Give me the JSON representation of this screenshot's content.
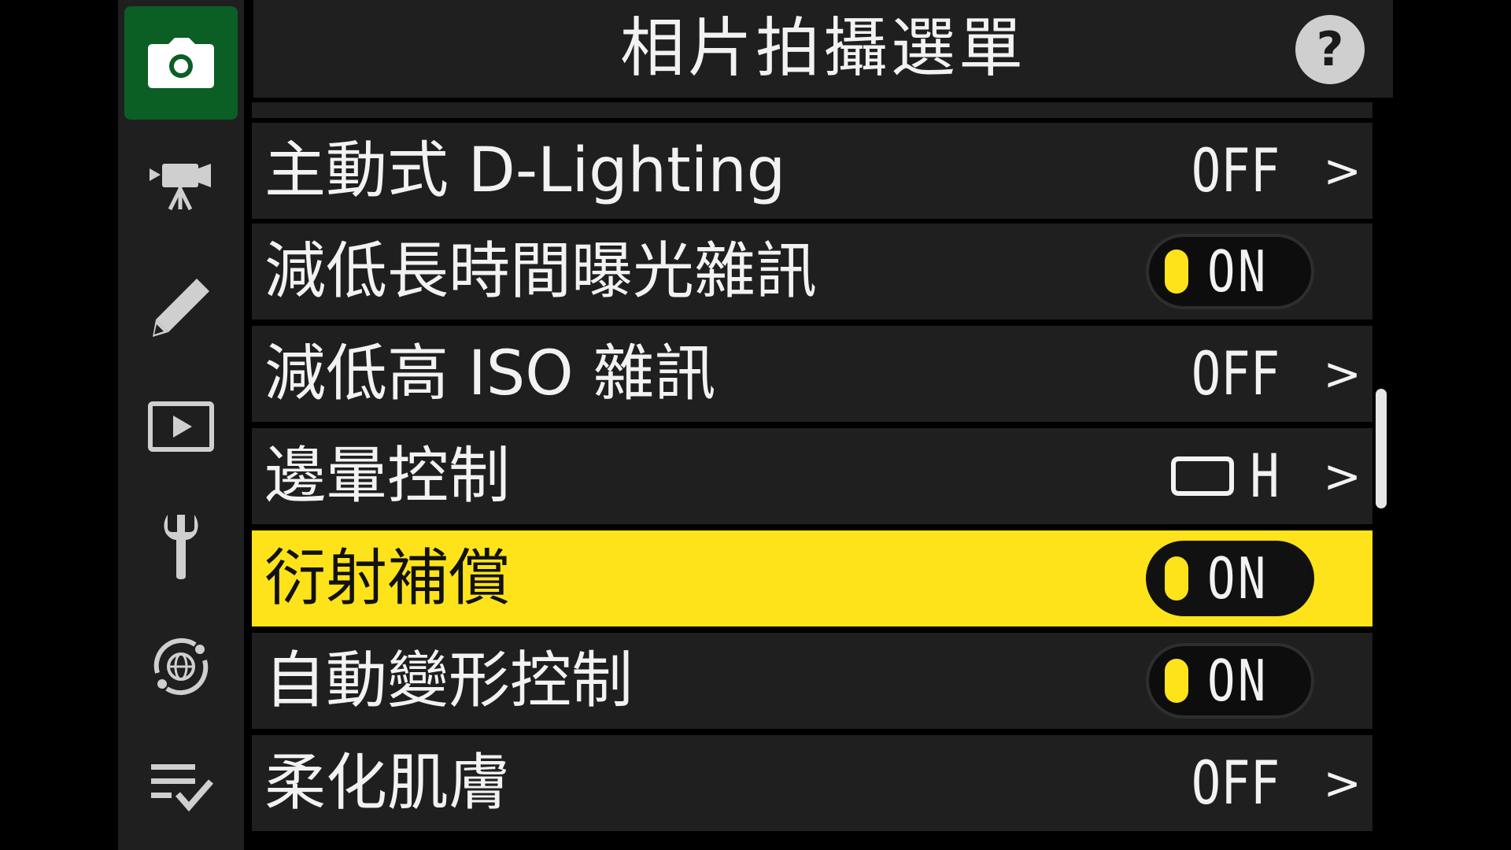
{
  "header": {
    "title": "相片拍攝選單",
    "help_label": "?"
  },
  "sidebar": {
    "tabs": [
      {
        "icon": "camera-icon",
        "active": true
      },
      {
        "icon": "movie-camera-icon",
        "active": false
      },
      {
        "icon": "pencil-icon",
        "active": false
      },
      {
        "icon": "playback-icon",
        "active": false
      },
      {
        "icon": "wrench-icon",
        "active": false
      },
      {
        "icon": "network-icon",
        "active": false
      },
      {
        "icon": "my-menu-icon",
        "active": false
      }
    ]
  },
  "menu": {
    "items": [
      {
        "label": "主動式 D-Lighting",
        "value": "OFF",
        "type": "value"
      },
      {
        "label": "減低長時間曝光雜訊",
        "value": "ON",
        "type": "toggle"
      },
      {
        "label": "減低高 ISO 雜訊",
        "value": "OFF",
        "type": "value"
      },
      {
        "label": "邊暈控制",
        "value": "H",
        "type": "value-icon"
      },
      {
        "label": "衍射補償",
        "value": "ON",
        "type": "toggle",
        "selected": true
      },
      {
        "label": "自動變形控制",
        "value": "ON",
        "type": "toggle"
      },
      {
        "label": "柔化肌膚",
        "value": "OFF",
        "type": "value"
      }
    ],
    "chevron": ">"
  },
  "colors": {
    "selected_row": "#ffe31a",
    "active_tab": "#0b5e24",
    "row_background": "#1f1f1f",
    "toggle_knob": "#ffe31a"
  }
}
